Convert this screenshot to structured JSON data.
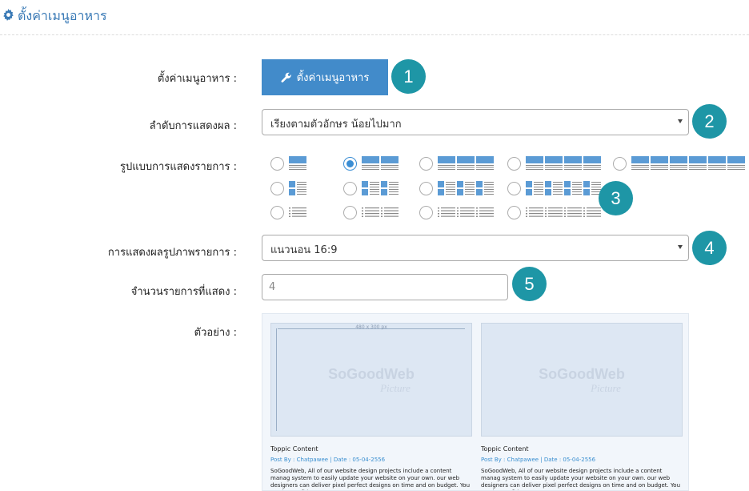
{
  "header": {
    "title": "ตั้งค่าเมนูอาหาร",
    "icon": "gear-icon",
    "color": "#3a7ab6"
  },
  "form": {
    "menu_settings": {
      "label": "ตั้งค่าเมนูอาหาร :",
      "button_label": "ตั้งค่าเมนูอาหาร",
      "button_icon": "wrench-icon",
      "badge": "1"
    },
    "sort_order": {
      "label": "ลำดับการแสดงผล :",
      "value": "เรียงตามตัวอักษร น้อยไปมาก",
      "badge": "2"
    },
    "display_layout": {
      "label": "รูปแบบการแสดงรายการ :",
      "badge": "3",
      "selected_index": 1
    },
    "image_display": {
      "label": "การแสดงผลรูปภาพรายการ :",
      "value": "แนวนอน 16:9",
      "badge": "4"
    },
    "item_count": {
      "label": "จำนวนรายการที่แสดง :",
      "value": "4",
      "badge": "5"
    },
    "preview": {
      "label": "ตัวอย่าง :"
    }
  },
  "preview_cards": [
    {
      "image_size": "480 x 300 px",
      "watermark": "SoGoodWeb",
      "watermark_sub": "Picture",
      "title": "Toppic Content",
      "meta": "Post By : Chatpawee  |  Date : 05-04-2556",
      "desc": "SoGoodWeb, All of our website design projects include a content manag system to easily update your website on your own. our web designers can deliver pixel perfect designs on time and on budget. You can be confident"
    },
    {
      "watermark": "SoGoodWeb",
      "watermark_sub": "Picture",
      "title": "Toppic Content",
      "meta": "Post By : Chatpawee  |  Date : 05-04-2556",
      "desc": "SoGoodWeb, All of our website design projects include a content manag system to easily update your website on your own. our web designers can deliver pixel perfect designs on time and on budget. You can be confident"
    }
  ],
  "colors": {
    "primary": "#428bca",
    "badge": "#1e96a6",
    "layout_icon": "#5b9bd5"
  }
}
